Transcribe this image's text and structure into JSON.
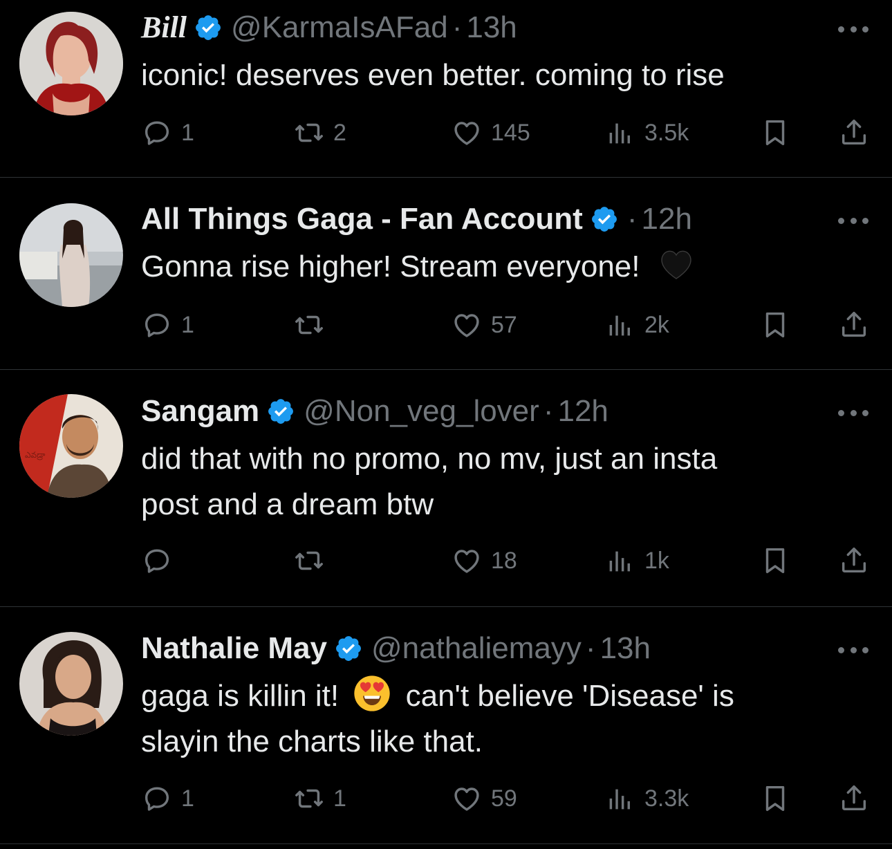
{
  "tweets": [
    {
      "name": "Bill",
      "handle": "@KarmaIsAFad",
      "time": "13h",
      "text": "iconic! deserves even better. coming to rise",
      "replies": "1",
      "retweets": "2",
      "likes": "145",
      "views": "3.5k"
    },
    {
      "name": "All Things Gaga - Fan Account",
      "handle": "",
      "time": "12h",
      "text": "Gonna rise higher! Stream everyone!",
      "emoji": "black-heart-icon",
      "replies": "1",
      "retweets": "",
      "likes": "57",
      "views": "2k"
    },
    {
      "name": "Sangam",
      "handle": "@Non_veg_lover",
      "time": "12h",
      "text_line1": "did that with no promo, no mv, just an insta",
      "text_line2": "post and a dream btw",
      "replies": "",
      "retweets": "",
      "likes": "18",
      "views": "1k"
    },
    {
      "name": "Nathalie May",
      "handle": "@nathaliemayy",
      "time": "13h",
      "text_before_emoji": "gaga is killin it!",
      "emoji": "heart-eyes-emoji",
      "text_after_emoji": "can't believe 'Disease' is",
      "text_line2": "slayin the charts like that.",
      "replies": "1",
      "retweets": "1",
      "likes": "59",
      "views": "3.3k"
    }
  ],
  "separator": "·",
  "colors": {
    "background": "#000000",
    "text": "#e7e9ea",
    "muted": "#71767b",
    "verified": "#1d9bf0",
    "divider": "#2f3336"
  }
}
